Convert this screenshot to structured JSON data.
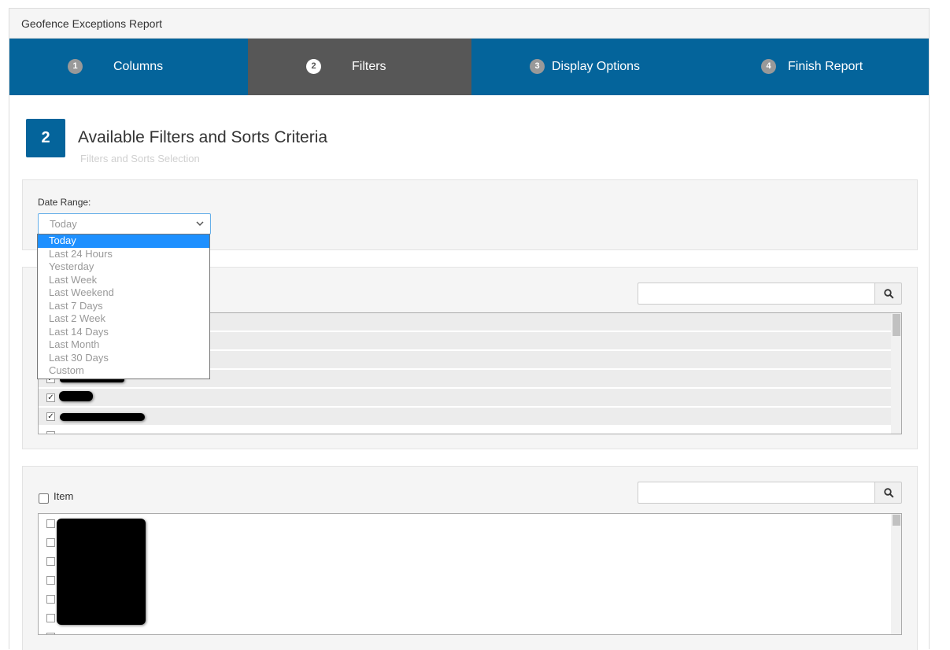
{
  "panel": {
    "title": "Geofence Exceptions Report"
  },
  "steps": [
    {
      "number": "1",
      "label": "Columns"
    },
    {
      "number": "2",
      "label": "Filters"
    },
    {
      "number": "3",
      "label": "Display Options"
    },
    {
      "number": "4",
      "label": "Finish Report"
    }
  ],
  "active_step": "2",
  "section": {
    "number": "2",
    "title": "Available Filters and Sorts Criteria",
    "subtitle": "Filters and Sorts Selection"
  },
  "date_range": {
    "label": "Date Range:",
    "selected": "Today",
    "options": [
      "Today",
      "Last 24 Hours",
      "Yesterday",
      "Last Week",
      "Last Weekend",
      "Last 7 Days",
      "Last 2 Week",
      "Last 14 Days",
      "Last Month",
      "Last 30 Days",
      "Custom"
    ]
  },
  "item_filter": {
    "label": "Item"
  },
  "icons": {
    "search": "search-icon",
    "dropdown": "chevron-down-icon",
    "check": "checkmark-icon"
  },
  "colors": {
    "primary": "#04649b",
    "active_step": "#575757",
    "selected_option": "#1e90ff"
  }
}
